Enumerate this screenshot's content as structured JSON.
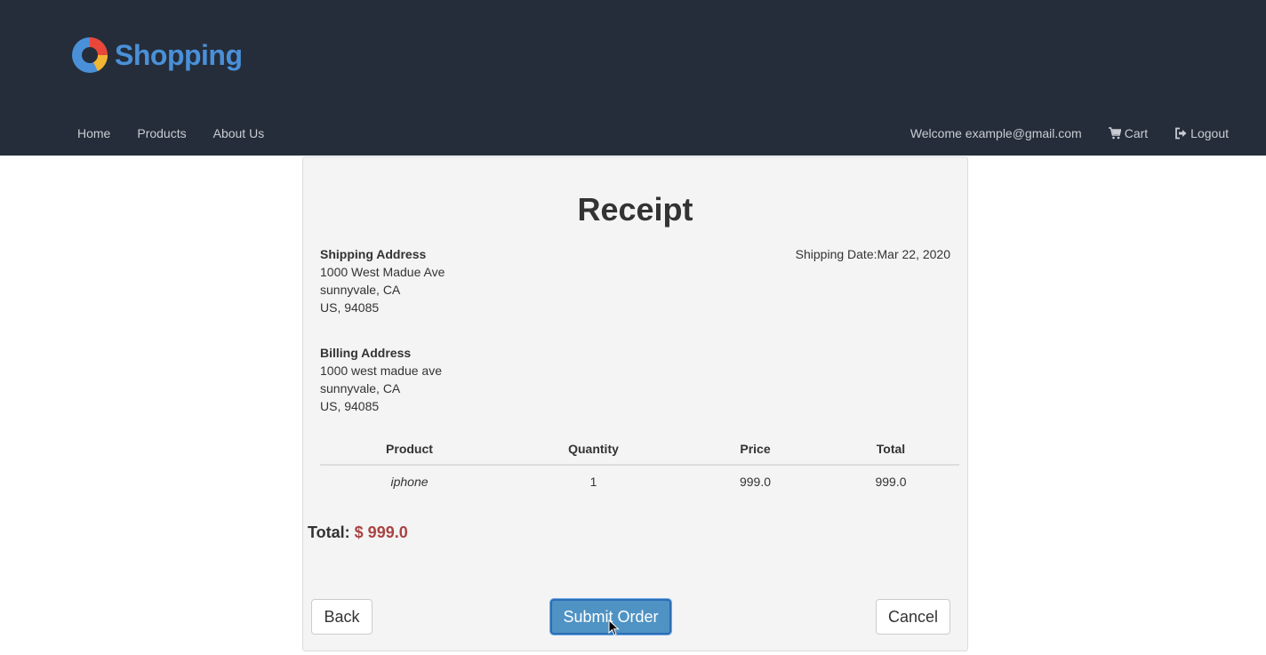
{
  "brand": {
    "name": "Shopping"
  },
  "nav": {
    "left": [
      "Home",
      "Products",
      "About Us"
    ],
    "welcome": "Welcome example@gmail.com",
    "cart": "Cart",
    "logout": "Logout"
  },
  "receipt": {
    "title": "Receipt",
    "shipping_address": {
      "title": "Shipping Address",
      "line1": "1000 West Madue Ave",
      "line2": "sunnyvale, CA",
      "line3": "US, 94085"
    },
    "shipping_date": "Shipping Date:Mar 22, 2020",
    "billing_address": {
      "title": "Billing Address",
      "line1": "1000 west madue ave",
      "line2": "sunnyvale, CA",
      "line3": "US, 94085"
    },
    "table": {
      "headers": [
        "Product",
        "Quantity",
        "Price",
        "Total"
      ],
      "rows": [
        [
          "iphone",
          "1",
          "999.0",
          "999.0"
        ]
      ]
    },
    "total_label": "Total:",
    "total_value": "$ 999.0"
  },
  "actions": {
    "back": "Back",
    "submit": "Submit Order",
    "cancel": "Cancel"
  },
  "colors": {
    "header_bg": "#252d3a",
    "brand_blue": "#4a90d9",
    "submit_bg": "#4f93c4",
    "total_red": "#a94442"
  }
}
